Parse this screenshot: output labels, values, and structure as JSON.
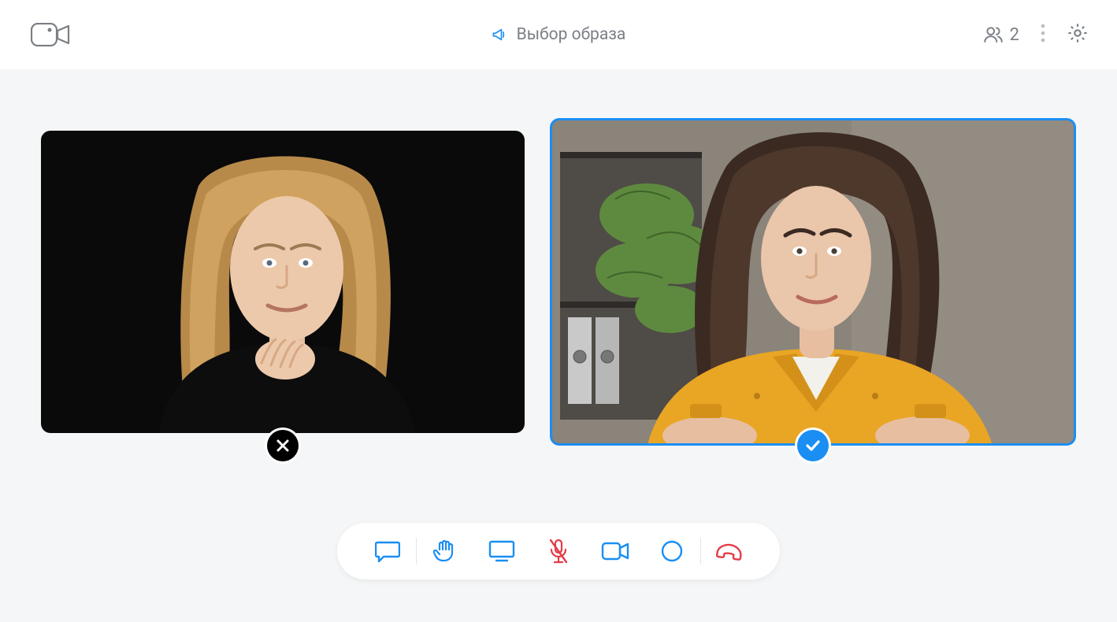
{
  "header": {
    "title": "Выбор образа",
    "participants_count": "2"
  },
  "icons": {
    "logo": "camera-logo-icon",
    "megaphone": "megaphone-icon",
    "people": "people-icon",
    "more": "more-vertical-icon",
    "settings": "gear-icon",
    "reject": "close-circle-icon",
    "accept": "check-circle-icon"
  },
  "participants": [
    {
      "selected": false,
      "status": "rejected",
      "desc": "Woman with blond hair on black background"
    },
    {
      "selected": true,
      "status": "accepted",
      "desc": "Woman with brown hair in yellow shirt, office background"
    }
  ],
  "toolbar": {
    "chat": "chat-icon",
    "hand": "raise-hand-icon",
    "screen": "share-screen-icon",
    "mic": "mic-muted-icon",
    "camera": "camera-icon",
    "record": "record-icon",
    "hangup": "hangup-icon"
  },
  "colors": {
    "accent": "#1a8ef2",
    "danger": "#e63b47"
  }
}
